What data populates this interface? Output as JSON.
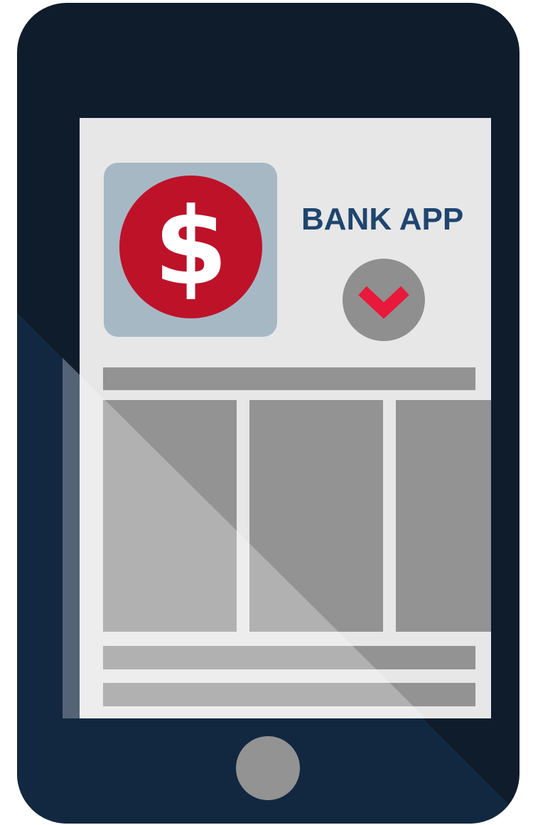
{
  "app": {
    "title": "BANK APP",
    "logo_symbol": "$",
    "logo_icon": "dollar-sign-icon",
    "dropdown_icon": "chevron-down-icon"
  },
  "colors": {
    "device_body": "#0f1c2c",
    "device_lower": "#13283e",
    "screen_bg": "#e7e7e7",
    "logo_tile": "#a7b8c5",
    "logo_circle": "#be1229",
    "title_text": "#1f456f",
    "dropdown_circle": "#8f8f8f",
    "chevron": "#e8193a",
    "placeholder_block": "#939393",
    "home_button": "#939393"
  },
  "content": {
    "tiles": 3,
    "row_bars": 2
  }
}
